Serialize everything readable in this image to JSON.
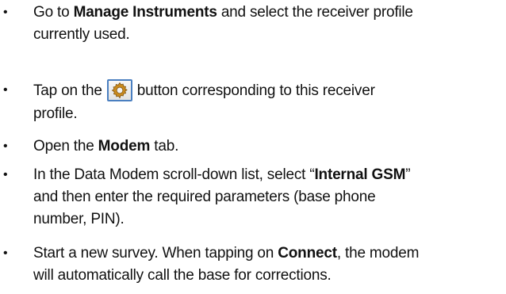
{
  "bullet_char": "•",
  "steps": [
    {
      "pre": "Go to ",
      "bold": "Manage Instruments",
      "post_line1": " and select the receiver profile",
      "line2": "currently used."
    },
    {
      "pre": "Tap on the",
      "icon": "gear-icon",
      "post_line1": "button corresponding to this receiver",
      "line2": "profile."
    },
    {
      "pre": "Open the ",
      "bold": "Modem",
      "post": " tab."
    },
    {
      "pre": "In the Data Modem scroll-down list, select “",
      "bold": "Internal GSM",
      "post_line1": "”",
      "line2": "and then enter the required parameters (base phone",
      "line3": "number, PIN)."
    },
    {
      "pre": "Start a new survey. When tapping on ",
      "bold": "Connect",
      "post_line1": ", the modem",
      "line2": "will automatically call the base for corrections."
    }
  ],
  "colors": {
    "text": "#111111",
    "icon_border": "#4a7fc0",
    "gear": "#c98a1e"
  }
}
